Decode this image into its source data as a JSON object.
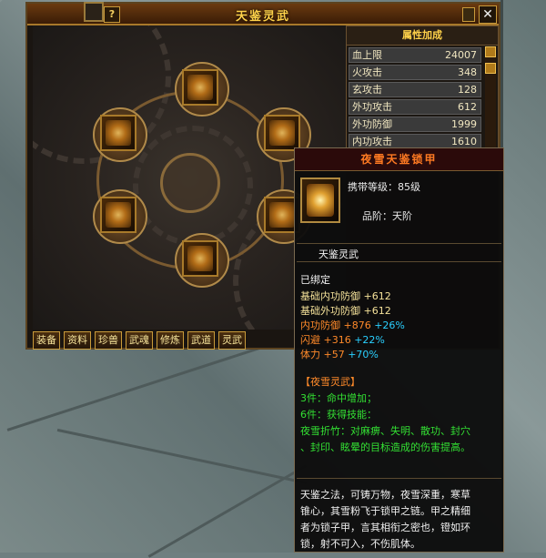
{
  "window": {
    "title": "天鉴灵武",
    "help_label": "?",
    "close_label": "✕"
  },
  "tabs": [
    "装备",
    "资料",
    "珍兽",
    "武魂",
    "修炼",
    "武道",
    "灵武"
  ],
  "attributes": {
    "header": "属性加成",
    "rows": [
      {
        "label": "血上限",
        "value": "24007"
      },
      {
        "label": "火攻击",
        "value": "348"
      },
      {
        "label": "玄攻击",
        "value": "128"
      },
      {
        "label": "外功攻击",
        "value": "612"
      },
      {
        "label": "外功防御",
        "value": "1999"
      },
      {
        "label": "内功攻击",
        "value": "1610"
      }
    ]
  },
  "tooltip": {
    "title": "夜雪天鉴锁甲",
    "level_req": "携带等级：85级",
    "grade": "品阶：天阶",
    "category": "天鉴灵武",
    "bound": "已绑定",
    "stats": [
      {
        "label": "基础内功防御",
        "base": "+612",
        "extra": ""
      },
      {
        "label": "基础外功防御",
        "base": "+612",
        "extra": ""
      },
      {
        "label": "内功防御",
        "base": "+876",
        "extra": "+26%"
      },
      {
        "label": "闪避",
        "base": "+316",
        "extra": "+22%"
      },
      {
        "label": "体力",
        "base": "+57",
        "extra": "+70%"
      }
    ],
    "set_name": "【夜雪灵武】",
    "set_lines": [
      "3件：命中增加；",
      "6件：获得技能：",
      "夜雪折竹：对麻痹、失明、散功、封穴",
      "、封印、眩晕的目标造成的伤害提高。"
    ],
    "description": [
      "天鉴之法，可铸万物，夜雪深重，寒草",
      "锥心，其雪粉飞于锁甲之链。甲之精细",
      "者为锁子甲，言其相衔之密也，镫如环",
      "锁，射不可入，不伤肌体。"
    ]
  }
}
